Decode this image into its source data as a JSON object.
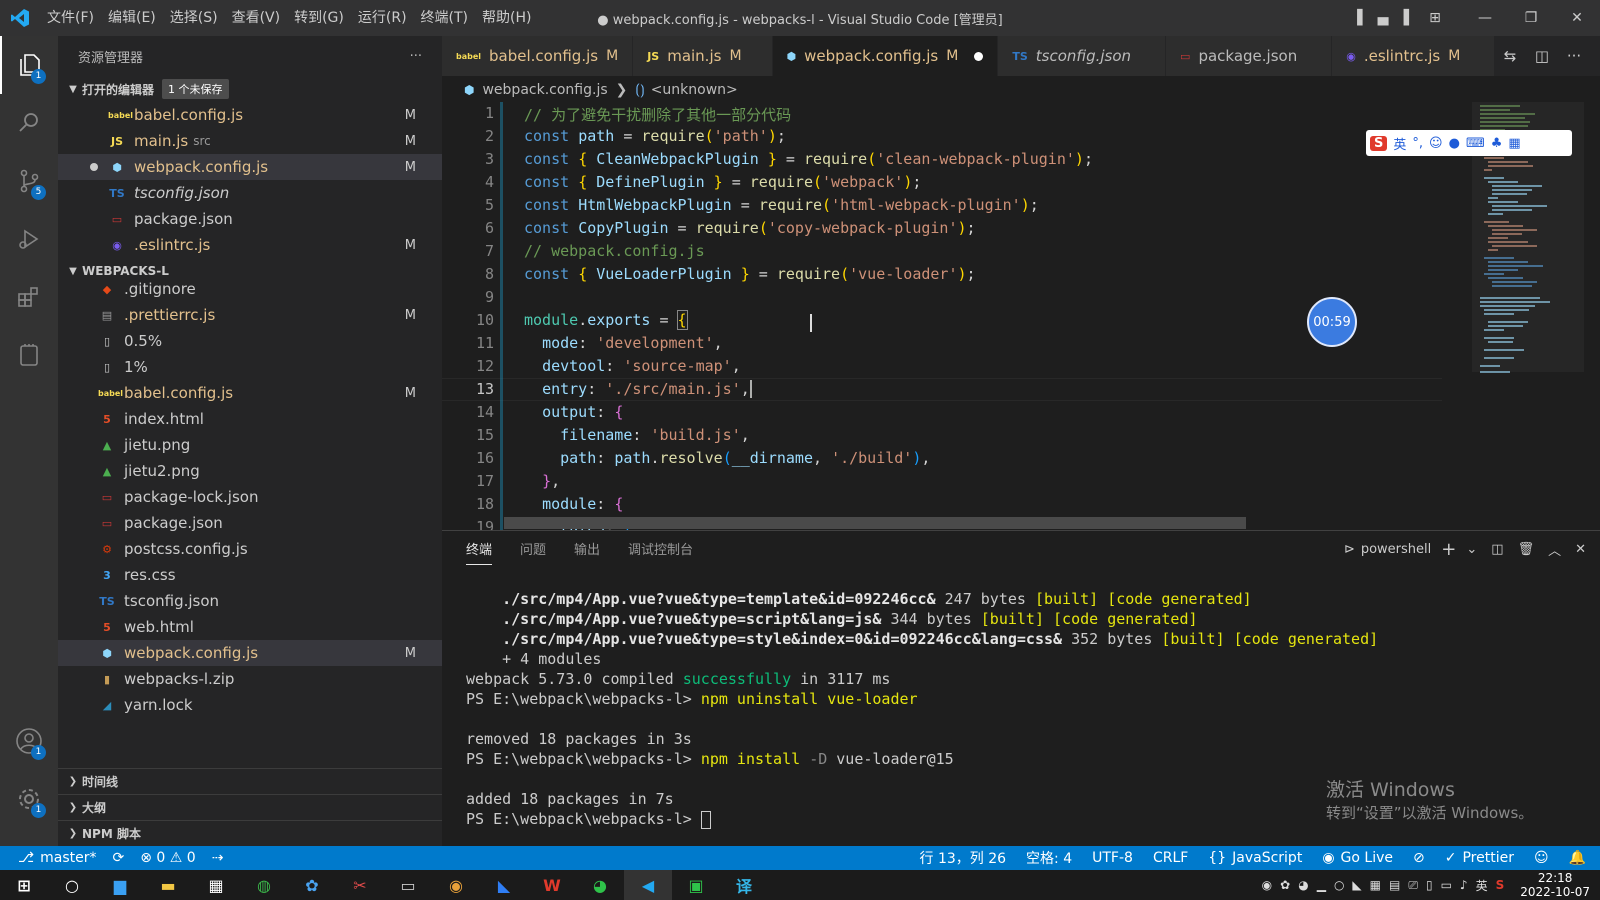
{
  "titlebar": {
    "title": "● webpack.config.js - webpacks-l - Visual Studio Code [管理员]",
    "menu": [
      "文件(F)",
      "编辑(E)",
      "选择(S)",
      "查看(V)",
      "转到(G)",
      "运行(R)",
      "终端(T)",
      "帮助(H)"
    ]
  },
  "activity": {
    "explorer_badge": "1",
    "scm_badge": "5",
    "accounts_badge": "1",
    "settings_badge": "1"
  },
  "sidebar": {
    "title": "资源管理器",
    "more": "···",
    "open_editors": {
      "label": "打开的编辑器",
      "unsaved": "1 个未保存",
      "items": [
        {
          "icon": "babel",
          "name": "babel.config.js",
          "mark": "M"
        },
        {
          "icon": "JS",
          "name": "main.js",
          "sub": "src",
          "mark": "M"
        },
        {
          "icon": "webpack",
          "name": "webpack.config.js",
          "mark": "M"
        },
        {
          "icon": "TS",
          "name": "tsconfig.json",
          "mark": ""
        },
        {
          "icon": "{}",
          "name": "package.json",
          "mark": ""
        },
        {
          "icon": "eslint",
          "name": ".eslintrc.js",
          "mark": "M"
        }
      ]
    },
    "workspace": {
      "label": "WEBPACKS-L",
      "items": [
        {
          "name": ".gitignore",
          "mark": ""
        },
        {
          "name": ".prettierrc.js",
          "mark": "M"
        },
        {
          "name": "0.5%",
          "mark": ""
        },
        {
          "name": "1%",
          "mark": ""
        },
        {
          "name": "babel.config.js",
          "mark": "M"
        },
        {
          "name": "index.html",
          "mark": ""
        },
        {
          "name": "jietu.png",
          "mark": ""
        },
        {
          "name": "jietu2.png",
          "mark": ""
        },
        {
          "name": "package-lock.json",
          "mark": ""
        },
        {
          "name": "package.json",
          "mark": ""
        },
        {
          "name": "postcss.config.js",
          "mark": ""
        },
        {
          "name": "res.css",
          "mark": ""
        },
        {
          "name": "tsconfig.json",
          "mark": ""
        },
        {
          "name": "web.html",
          "mark": ""
        },
        {
          "name": "webpack.config.js",
          "mark": "M"
        },
        {
          "name": "webpacks-l.zip",
          "mark": ""
        },
        {
          "name": "yarn.lock",
          "mark": ""
        }
      ]
    },
    "bottom_sections": [
      "时间线",
      "大纲",
      "NPM 脚本"
    ]
  },
  "tabs": [
    {
      "icon": "babel",
      "name": "babel.config.js",
      "mark": "M"
    },
    {
      "icon": "JS",
      "name": "main.js",
      "mark": "M"
    },
    {
      "icon": "webpack",
      "name": "webpack.config.js",
      "mark": "M"
    },
    {
      "icon": "TS",
      "name": "tsconfig.json",
      "mark": ""
    },
    {
      "icon": "{}",
      "name": "package.json",
      "mark": ""
    },
    {
      "icon": "eslint",
      "name": ".eslintrc.js",
      "mark": "M"
    }
  ],
  "breadcrumb": {
    "file": "webpack.config.js",
    "symbol": "<unknown>"
  },
  "editor": {
    "line_numbers": [
      "1",
      "2",
      "3",
      "4",
      "5",
      "6",
      "7",
      "8",
      "9",
      "10",
      "11",
      "12",
      "13",
      "14",
      "15",
      "16",
      "17",
      "18",
      "19"
    ],
    "current_line": "13"
  },
  "overlay": {
    "timer": "00:59",
    "ime_label": "英"
  },
  "panel": {
    "tabs": [
      "终端",
      "问题",
      "输出",
      "调试控制台"
    ],
    "shell": "powershell",
    "terminal": {
      "l1_path": "./src/mp4/App.vue?vue&type=template&id=092246cc&",
      "l1_size": " 247 bytes ",
      "l1_tag": "[built] [code generated]",
      "l2_path": "./src/mp4/App.vue?vue&type=script&lang=js&",
      "l2_size": " 344 bytes ",
      "l2_tag": "[built] [code generated]",
      "l3_path": "./src/mp4/App.vue?vue&type=style&index=0&id=092246cc&lang=css&",
      "l3_size": " 352 bytes ",
      "l3_tag": "[built] [code generated]",
      "l4": "+ 4 modules",
      "l5_a": "webpack 5.73.0 compiled ",
      "l5_b": "successfully",
      "l5_c": " in 3117 ms",
      "prompt": "PS E:\\webpack\\webpacks-l> ",
      "cmd1": "npm uninstall vue-loader",
      "l7": "removed 18 packages in 3s",
      "cmd2_a": "npm install ",
      "cmd2_b": "-D",
      "cmd2_c": " vue-loader@15",
      "l9": "added 18 packages in 7s"
    }
  },
  "watermark": {
    "line1": "激活 Windows",
    "line2": "转到“设置”以激活 Windows。"
  },
  "statusbar": {
    "branch": "master*",
    "errors": "⊗ 0 ⚠ 0",
    "position": "行 13，列 26",
    "spaces": "空格: 4",
    "encoding": "UTF-8",
    "eol": "CRLF",
    "language": "JavaScript",
    "golive": "Go Live",
    "prettier": "Prettier"
  },
  "taskbar": {
    "time": "22:18",
    "date": "2022-10-07",
    "ime": "英"
  },
  "colors": {
    "accent": "#007acc",
    "modified": "#e2c08d",
    "string": "#ce9178",
    "keyword": "#569cd6"
  }
}
